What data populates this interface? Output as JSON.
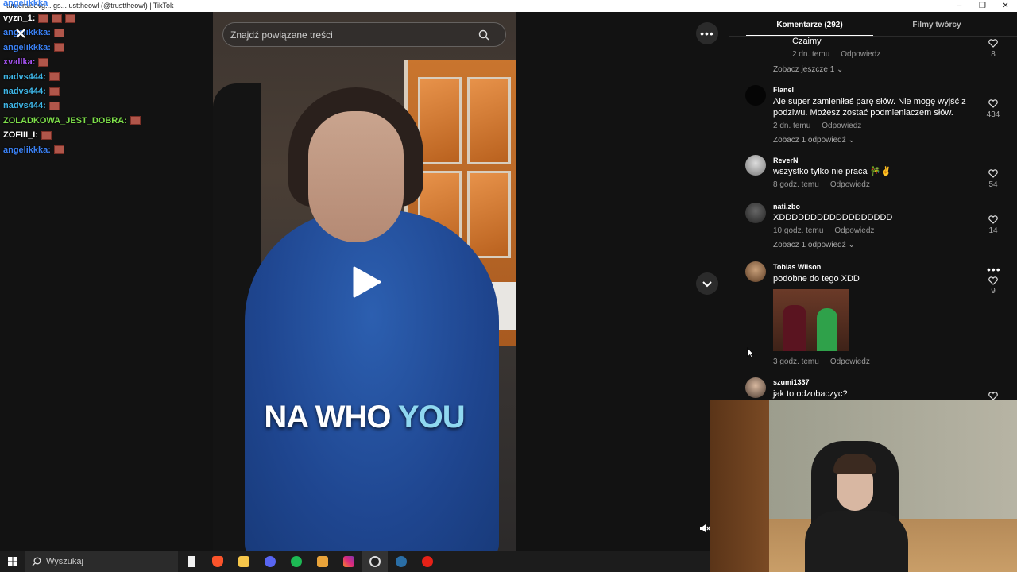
{
  "window": {
    "title": "tunteraisovg... gs... usttheowl (@trusttheowl) | TikTok"
  },
  "chat": {
    "top_name": "angelikkka",
    "lines": [
      {
        "name": "vyzn_1:",
        "color": "#ffffff",
        "emotes": 3
      },
      {
        "name": "angelikkka:",
        "color": "#3b82f6",
        "emotes": 1
      },
      {
        "name": "angelikkka:",
        "color": "#3b82f6",
        "emotes": 1
      },
      {
        "name": "xvallka:",
        "color": "#a855f7",
        "emotes": 1
      },
      {
        "name": "nadvs444:",
        "color": "#3fb7e8",
        "emotes": 1
      },
      {
        "name": "nadvs444:",
        "color": "#3fb7e8",
        "emotes": 1
      },
      {
        "name": "nadvs444:",
        "color": "#3fb7e8",
        "emotes": 1
      },
      {
        "name": "ZOLADKOWA_JEST_DOBRA:",
        "color": "#7ee04a",
        "emotes": 1
      },
      {
        "name": "ZOFIII_I:",
        "color": "#ffffff",
        "emotes": 1
      },
      {
        "name": "angelikkka:",
        "color": "#3b82f6",
        "emotes": 1
      }
    ]
  },
  "video": {
    "search_placeholder": "Znajdź powiązane treści",
    "caption_part1": "NA WHO ",
    "caption_part2": "YOU",
    "caption_highlight_color": "#8fd8f0"
  },
  "comments_panel": {
    "tab_comments": "Komentarze (292)",
    "tab_creator_videos": "Filmy twórcy",
    "comments": [
      {
        "user": "",
        "text": "Czaimy",
        "time": "2 dn. temu",
        "reply": "Odpowiedz",
        "likes": "8",
        "more_replies": "Zobacz jeszcze 1"
      },
      {
        "user": "Flanel",
        "text": "Ale super zamieniłaś parę słów. Nie mogę wyjść z podziwu. Możesz zostać podmieniaczem słów.",
        "time": "2 dn. temu",
        "reply": "Odpowiedz",
        "likes": "434",
        "more_replies": "Zobacz 1 odpowiedź"
      },
      {
        "user": "ReverN",
        "text": "wszystko tylko nie praca 🎋✌",
        "time": "8 godz. temu",
        "reply": "Odpowiedz",
        "likes": "54"
      },
      {
        "user": "nati.zbo",
        "text": "XDDDDDDDDDDDDDDDDDD",
        "time": "10 godz. temu",
        "reply": "Odpowiedz",
        "likes": "14",
        "more_replies": "Zobacz 1 odpowiedź"
      },
      {
        "user": "Tobias Wilson",
        "text": "podobne do tego XDD",
        "time": "3 godz. temu",
        "reply": "Odpowiedz",
        "likes": "9"
      },
      {
        "user": "szumi1337",
        "text": "jak to odzobaczyc?",
        "likes": ""
      }
    ]
  },
  "taskbar": {
    "search_placeholder": "Wyszukaj",
    "apps": [
      "file-icon",
      "brave-icon",
      "folder-icon",
      "discord-icon",
      "spotify-icon",
      "media-icon",
      "instagram-icon",
      "obs-icon",
      "steam-icon",
      "youtube-icon"
    ]
  }
}
